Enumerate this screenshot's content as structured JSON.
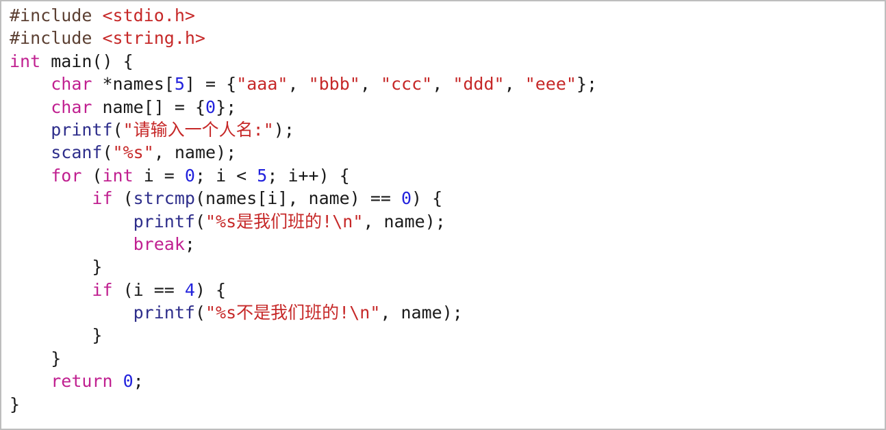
{
  "window": {
    "title": "C Source Code",
    "language": "c",
    "border_color": "#bdbdbd",
    "background": "#ffffff"
  },
  "theme": {
    "preprocessor": "#5C4033",
    "header": "#C62828",
    "keyword": "#C02090",
    "function": "#2E2E8B",
    "string": "#C62828",
    "number": "#2222DD",
    "plain": "#1a1a1a"
  },
  "code": {
    "line_count": 17,
    "indent_size": 4,
    "plain_text": "#include <stdio.h>\n#include <string.h>\nint main() {\n    char *names[5] = {\"aaa\", \"bbb\", \"ccc\", \"ddd\", \"eee\"};\n    char name[] = {0};\n    printf(\"请输入一个人名:\");\n    scanf(\"%s\", name);\n    for (int i = 0; i < 5; i++) {\n        if (strcmp(names[i], name) == 0) {\n            printf(\"%s是我们班的!\\n\", name);\n            break;\n        }\n        if (i == 4) {\n            printf(\"%s不是我们班的!\\n\", name);\n        }\n    }\n    return 0;\n}",
    "lines": [
      {
        "n": 1,
        "tokens": [
          {
            "k": "pre",
            "v": "#include "
          },
          {
            "k": "hdr",
            "v": "<stdio.h>"
          }
        ]
      },
      {
        "n": 2,
        "tokens": [
          {
            "k": "pre",
            "v": "#include "
          },
          {
            "k": "hdr",
            "v": "<string.h>"
          }
        ]
      },
      {
        "n": 3,
        "tokens": [
          {
            "k": "kw",
            "v": "int"
          },
          {
            "k": "plain",
            "v": " main() {"
          }
        ]
      },
      {
        "n": 4,
        "tokens": [
          {
            "k": "plain",
            "v": "    "
          },
          {
            "k": "kw",
            "v": "char"
          },
          {
            "k": "plain",
            "v": " *names["
          },
          {
            "k": "num",
            "v": "5"
          },
          {
            "k": "plain",
            "v": "] = {"
          },
          {
            "k": "str",
            "v": "\"aaa\""
          },
          {
            "k": "plain",
            "v": ", "
          },
          {
            "k": "str",
            "v": "\"bbb\""
          },
          {
            "k": "plain",
            "v": ", "
          },
          {
            "k": "str",
            "v": "\"ccc\""
          },
          {
            "k": "plain",
            "v": ", "
          },
          {
            "k": "str",
            "v": "\"ddd\""
          },
          {
            "k": "plain",
            "v": ", "
          },
          {
            "k": "str",
            "v": "\"eee\""
          },
          {
            "k": "plain",
            "v": "};"
          }
        ]
      },
      {
        "n": 5,
        "tokens": [
          {
            "k": "plain",
            "v": "    "
          },
          {
            "k": "kw",
            "v": "char"
          },
          {
            "k": "plain",
            "v": " name[] = {"
          },
          {
            "k": "num",
            "v": "0"
          },
          {
            "k": "plain",
            "v": "};"
          }
        ]
      },
      {
        "n": 6,
        "tokens": [
          {
            "k": "plain",
            "v": "    "
          },
          {
            "k": "fn",
            "v": "printf"
          },
          {
            "k": "plain",
            "v": "("
          },
          {
            "k": "str",
            "v": "\""
          },
          {
            "k": "cjk",
            "v": "请输入一个人名"
          },
          {
            "k": "str",
            "v": ":\""
          },
          {
            "k": "plain",
            "v": ");"
          }
        ]
      },
      {
        "n": 7,
        "tokens": [
          {
            "k": "plain",
            "v": "    "
          },
          {
            "k": "fn",
            "v": "scanf"
          },
          {
            "k": "plain",
            "v": "("
          },
          {
            "k": "str",
            "v": "\"%s\""
          },
          {
            "k": "plain",
            "v": ", name);"
          }
        ]
      },
      {
        "n": 8,
        "tokens": [
          {
            "k": "plain",
            "v": "    "
          },
          {
            "k": "kw",
            "v": "for"
          },
          {
            "k": "plain",
            "v": " ("
          },
          {
            "k": "kw",
            "v": "int"
          },
          {
            "k": "plain",
            "v": " i = "
          },
          {
            "k": "num",
            "v": "0"
          },
          {
            "k": "plain",
            "v": "; i < "
          },
          {
            "k": "num",
            "v": "5"
          },
          {
            "k": "plain",
            "v": "; i++) {"
          }
        ]
      },
      {
        "n": 9,
        "tokens": [
          {
            "k": "plain",
            "v": "        "
          },
          {
            "k": "kw",
            "v": "if"
          },
          {
            "k": "plain",
            "v": " ("
          },
          {
            "k": "fn",
            "v": "strcmp"
          },
          {
            "k": "plain",
            "v": "(names[i], name) == "
          },
          {
            "k": "num",
            "v": "0"
          },
          {
            "k": "plain",
            "v": ") {"
          }
        ]
      },
      {
        "n": 10,
        "tokens": [
          {
            "k": "plain",
            "v": "            "
          },
          {
            "k": "fn",
            "v": "printf"
          },
          {
            "k": "plain",
            "v": "("
          },
          {
            "k": "str",
            "v": "\"%s"
          },
          {
            "k": "cjk",
            "v": "是我们班的"
          },
          {
            "k": "str",
            "v": "!\\n\""
          },
          {
            "k": "plain",
            "v": ", name);"
          }
        ]
      },
      {
        "n": 11,
        "tokens": [
          {
            "k": "plain",
            "v": "            "
          },
          {
            "k": "kw",
            "v": "break"
          },
          {
            "k": "plain",
            "v": ";"
          }
        ]
      },
      {
        "n": 12,
        "tokens": [
          {
            "k": "plain",
            "v": "        }"
          }
        ]
      },
      {
        "n": 13,
        "tokens": [
          {
            "k": "plain",
            "v": "        "
          },
          {
            "k": "kw",
            "v": "if"
          },
          {
            "k": "plain",
            "v": " (i == "
          },
          {
            "k": "num",
            "v": "4"
          },
          {
            "k": "plain",
            "v": ") {"
          }
        ]
      },
      {
        "n": 14,
        "tokens": [
          {
            "k": "plain",
            "v": "            "
          },
          {
            "k": "fn",
            "v": "printf"
          },
          {
            "k": "plain",
            "v": "("
          },
          {
            "k": "str",
            "v": "\"%s"
          },
          {
            "k": "cjk",
            "v": "不是我们班的"
          },
          {
            "k": "str",
            "v": "!\\n\""
          },
          {
            "k": "plain",
            "v": ", name);"
          }
        ]
      },
      {
        "n": 15,
        "tokens": [
          {
            "k": "plain",
            "v": "        }"
          }
        ]
      },
      {
        "n": 16,
        "tokens": [
          {
            "k": "plain",
            "v": "    }"
          }
        ]
      },
      {
        "n": 17,
        "tokens": [
          {
            "k": "plain",
            "v": "    "
          },
          {
            "k": "kw",
            "v": "return"
          },
          {
            "k": "plain",
            "v": " "
          },
          {
            "k": "num",
            "v": "0"
          },
          {
            "k": "plain",
            "v": ";"
          }
        ]
      },
      {
        "n": 18,
        "tokens": [
          {
            "k": "plain",
            "v": "}"
          }
        ]
      }
    ]
  }
}
